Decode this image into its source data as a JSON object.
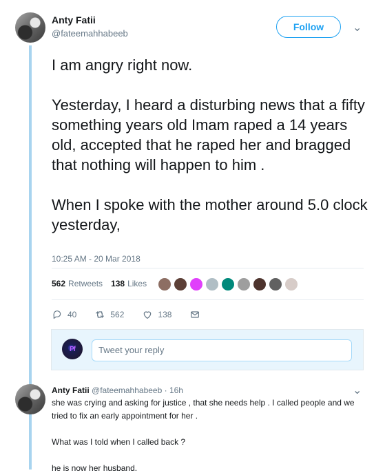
{
  "tweet": {
    "author": {
      "name": "Anty Fatii",
      "handle": "@fateemahhabeeb"
    },
    "follow_label": "Follow",
    "text": "I am angry right now.\n\nYesterday, I heard a disturbing news that a fifty something years old Imam raped a 14 years old, accepted that he raped her and bragged that nothing will happen to him .\n\nWhen I spoke with the mother around 5.0 clock yesterday,",
    "timestamp": "10:25 AM - 20 Mar 2018",
    "stats": {
      "retweets_count": "562",
      "retweets_label": "Retweets",
      "likes_count": "138",
      "likes_label": "Likes"
    },
    "liker_avatars": [
      {
        "name": "liker-avatar-1",
        "color": "#8d6e63"
      },
      {
        "name": "liker-avatar-2",
        "color": "#5d4037"
      },
      {
        "name": "liker-avatar-3",
        "color": "#e040fb"
      },
      {
        "name": "liker-avatar-4",
        "color": "#b0bec5"
      },
      {
        "name": "liker-avatar-5",
        "color": "#00897b"
      },
      {
        "name": "liker-avatar-6",
        "color": "#9e9e9e"
      },
      {
        "name": "liker-avatar-7",
        "color": "#4e342e"
      },
      {
        "name": "liker-avatar-8",
        "color": "#616161"
      },
      {
        "name": "liker-avatar-9",
        "color": "#d7ccc8"
      }
    ],
    "actions": {
      "replies": "40",
      "retweets": "562",
      "likes": "138"
    }
  },
  "reply_box": {
    "placeholder": "Tweet your reply"
  },
  "reply_tweet": {
    "author_name": "Anty Fatii",
    "meta": "@fateemahhabeeb · 16h",
    "text": "she was crying and asking for justice , that she needs help . I called people and we tried to fix an early appointment for her .\n\nWhat was I told when I called back ?\n\nhe is now her husband."
  }
}
